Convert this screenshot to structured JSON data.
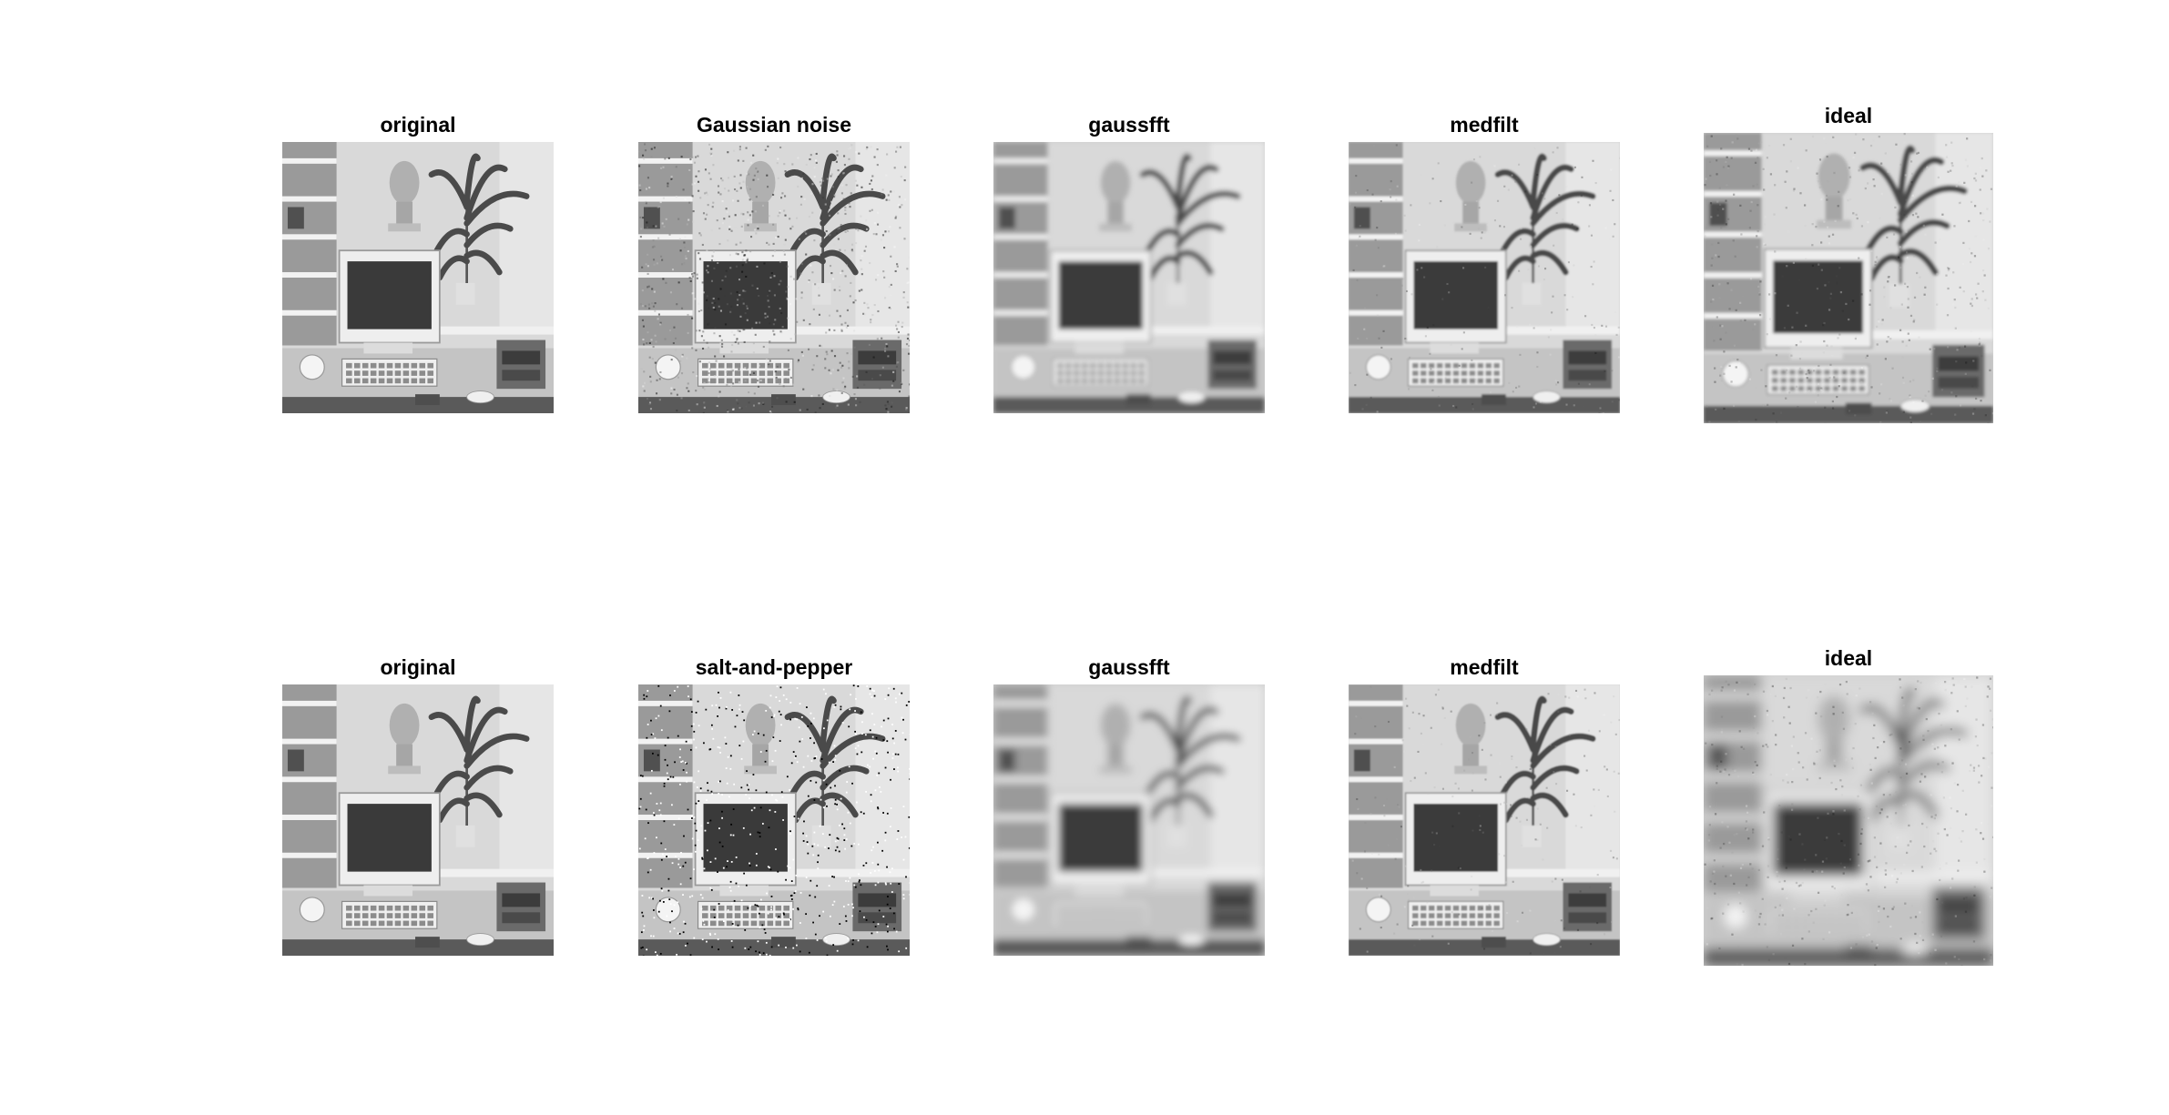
{
  "figure": {
    "rows": [
      {
        "panels": [
          {
            "title": "original",
            "variant": "clean"
          },
          {
            "title": "Gaussian noise",
            "variant": "gaussian"
          },
          {
            "title": "gaussfft",
            "variant": "blur"
          },
          {
            "title": "medfilt",
            "variant": "median"
          },
          {
            "title": "ideal",
            "variant": "ideal"
          }
        ]
      },
      {
        "panels": [
          {
            "title": "original",
            "variant": "clean"
          },
          {
            "title": "salt-and-pepper",
            "variant": "saltpepper"
          },
          {
            "title": "gaussfft",
            "variant": "heavyblur"
          },
          {
            "title": "medfilt",
            "variant": "median2"
          },
          {
            "title": "ideal",
            "variant": "idealblur"
          }
        ]
      }
    ],
    "image_subject": "grayscale office scene: bust, plant, CRT monitor, keyboard, desk",
    "colormap": "gray"
  }
}
